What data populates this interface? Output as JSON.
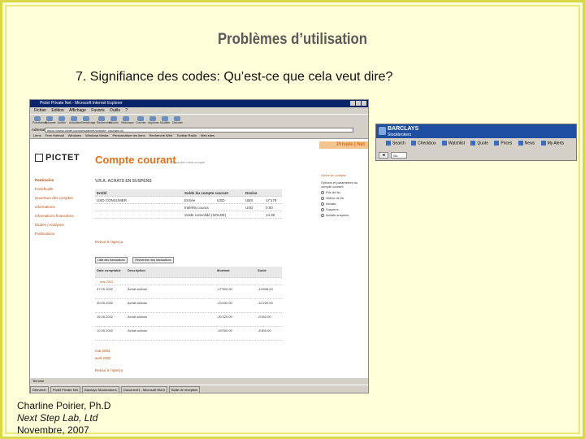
{
  "slide": {
    "title": "Problèmes d’utilisation",
    "subtitle": "7. Signifiance des codes:  Qu’est-ce que cela veut dire?",
    "credit_name": "Charline Poirier, Ph.D",
    "credit_org": "Next Step Lab, Ltd",
    "credit_date": "Novembre, 2007"
  },
  "browser": {
    "title": "Pictet Private Net - Microsoft Internet Explorer",
    "menu": [
      "Fichier",
      "Edition",
      "Affichage",
      "Favoris",
      "Outils",
      "?"
    ],
    "toolbar": [
      "Précédente",
      "Suivante",
      "Arrêter",
      "Actualiser",
      "Démarrage",
      "Rechercher",
      "Favoris",
      "Historique",
      "Courrier",
      "Imprimer",
      "Modifier",
      "Discuter"
    ],
    "address_label": "Adresse",
    "address_value": "https://www.pictet.com/privatenet/compte_courant.do",
    "links": [
      "Liens",
      "Free Hotmail",
      "Windows",
      "Windows Media",
      "Personnaliser les liens",
      "Recherche Web",
      "Toolbar Radio",
      "Mes sites"
    ],
    "status": "Terminé",
    "taskbar": [
      "Démarrer",
      "Pictet Private Net",
      "Barclays Stockbrokers",
      "Document1 - Microsoft Word",
      "Boîte de réception"
    ]
  },
  "page": {
    "brand": "PICTET",
    "private_net": "Private | Net",
    "title": "Compte courant",
    "title_sub": "Consulter votre compte",
    "section": "V.R.A. ACHATS EN SUSPENS",
    "nav": [
      "Patrimoine",
      "Portefeuille",
      "Ouverture des comptes",
      "Informations",
      "Informations financières",
      "Etudes / Analyses",
      "Publications"
    ],
    "right_header": "Ouvrir un compte",
    "right_text": "Options et paramètres du compte courant",
    "right_options": [
      "Prix de fin",
      "Valeur de fin",
      "Achats",
      "Suspens",
      "Achats suspens"
    ],
    "acct_headers": [
      "Entité",
      "Solde du compte courant",
      "Devise"
    ],
    "acct_rows": [
      [
        "USD CONSUMER",
        "Entrée",
        "USD",
        "UBS",
        "17'179"
      ],
      [
        "",
        "Intérêts courus",
        "",
        "USD",
        "0.00"
      ],
      [
        "",
        "Solde consolidé (SOLDE)",
        "",
        "",
        "14.30"
      ]
    ],
    "back_link": "Retour à l’aperçu",
    "buttons": [
      "Liste des transactions",
      "Rechercher des transactions"
    ],
    "tx_headers": [
      "Date comptable",
      "Description",
      "Montant",
      "Solde"
    ],
    "tx_groups": [
      "mai 2002",
      "avril 2002"
    ],
    "tx_rows": [
      [
        "07.05.2002",
        "Achat actions",
        "-27'500.00",
        "-13'808.00"
      ],
      [
        "30.05.2002",
        "Achat actions",
        "-23'400.00",
        "-10'220.00"
      ],
      [
        "15.05.2002",
        "Achat actions",
        "-20'320.00",
        "-9'260.00"
      ],
      [
        "10.05.2002",
        "Achat actions",
        "-15'000.00",
        "-4'800.00"
      ]
    ],
    "foot_links": [
      "mai 2002",
      "avril 2002",
      "Retour à l’aperçu"
    ]
  },
  "barclays": {
    "brand": "BARCLAYS",
    "brand_sub": "Stockbrokers",
    "tools": [
      "Search",
      "Checkbox",
      "Watchlist",
      "Quote",
      "Prices",
      "News",
      "My Alerts"
    ],
    "back": "◄",
    "select": "Go"
  }
}
